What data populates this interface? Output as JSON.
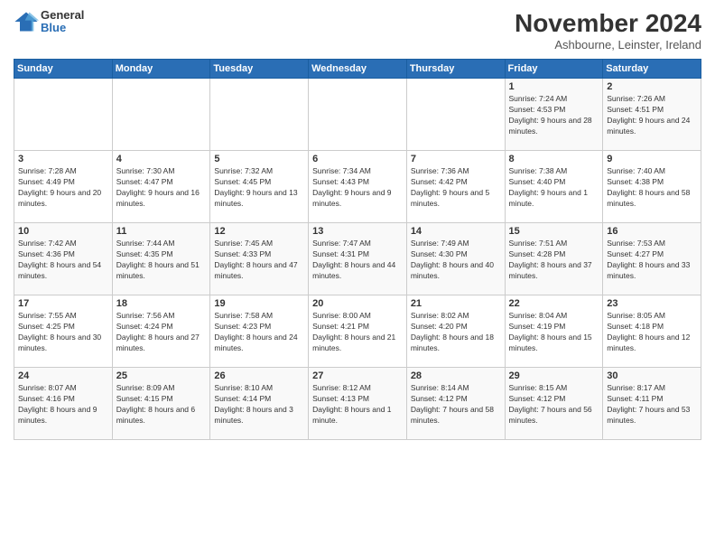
{
  "header": {
    "logo_general": "General",
    "logo_blue": "Blue",
    "month_title": "November 2024",
    "subtitle": "Ashbourne, Leinster, Ireland"
  },
  "days_of_week": [
    "Sunday",
    "Monday",
    "Tuesday",
    "Wednesday",
    "Thursday",
    "Friday",
    "Saturday"
  ],
  "weeks": [
    [
      {
        "day": "",
        "info": ""
      },
      {
        "day": "",
        "info": ""
      },
      {
        "day": "",
        "info": ""
      },
      {
        "day": "",
        "info": ""
      },
      {
        "day": "",
        "info": ""
      },
      {
        "day": "1",
        "info": "Sunrise: 7:24 AM\nSunset: 4:53 PM\nDaylight: 9 hours and 28 minutes."
      },
      {
        "day": "2",
        "info": "Sunrise: 7:26 AM\nSunset: 4:51 PM\nDaylight: 9 hours and 24 minutes."
      }
    ],
    [
      {
        "day": "3",
        "info": "Sunrise: 7:28 AM\nSunset: 4:49 PM\nDaylight: 9 hours and 20 minutes."
      },
      {
        "day": "4",
        "info": "Sunrise: 7:30 AM\nSunset: 4:47 PM\nDaylight: 9 hours and 16 minutes."
      },
      {
        "day": "5",
        "info": "Sunrise: 7:32 AM\nSunset: 4:45 PM\nDaylight: 9 hours and 13 minutes."
      },
      {
        "day": "6",
        "info": "Sunrise: 7:34 AM\nSunset: 4:43 PM\nDaylight: 9 hours and 9 minutes."
      },
      {
        "day": "7",
        "info": "Sunrise: 7:36 AM\nSunset: 4:42 PM\nDaylight: 9 hours and 5 minutes."
      },
      {
        "day": "8",
        "info": "Sunrise: 7:38 AM\nSunset: 4:40 PM\nDaylight: 9 hours and 1 minute."
      },
      {
        "day": "9",
        "info": "Sunrise: 7:40 AM\nSunset: 4:38 PM\nDaylight: 8 hours and 58 minutes."
      }
    ],
    [
      {
        "day": "10",
        "info": "Sunrise: 7:42 AM\nSunset: 4:36 PM\nDaylight: 8 hours and 54 minutes."
      },
      {
        "day": "11",
        "info": "Sunrise: 7:44 AM\nSunset: 4:35 PM\nDaylight: 8 hours and 51 minutes."
      },
      {
        "day": "12",
        "info": "Sunrise: 7:45 AM\nSunset: 4:33 PM\nDaylight: 8 hours and 47 minutes."
      },
      {
        "day": "13",
        "info": "Sunrise: 7:47 AM\nSunset: 4:31 PM\nDaylight: 8 hours and 44 minutes."
      },
      {
        "day": "14",
        "info": "Sunrise: 7:49 AM\nSunset: 4:30 PM\nDaylight: 8 hours and 40 minutes."
      },
      {
        "day": "15",
        "info": "Sunrise: 7:51 AM\nSunset: 4:28 PM\nDaylight: 8 hours and 37 minutes."
      },
      {
        "day": "16",
        "info": "Sunrise: 7:53 AM\nSunset: 4:27 PM\nDaylight: 8 hours and 33 minutes."
      }
    ],
    [
      {
        "day": "17",
        "info": "Sunrise: 7:55 AM\nSunset: 4:25 PM\nDaylight: 8 hours and 30 minutes."
      },
      {
        "day": "18",
        "info": "Sunrise: 7:56 AM\nSunset: 4:24 PM\nDaylight: 8 hours and 27 minutes."
      },
      {
        "day": "19",
        "info": "Sunrise: 7:58 AM\nSunset: 4:23 PM\nDaylight: 8 hours and 24 minutes."
      },
      {
        "day": "20",
        "info": "Sunrise: 8:00 AM\nSunset: 4:21 PM\nDaylight: 8 hours and 21 minutes."
      },
      {
        "day": "21",
        "info": "Sunrise: 8:02 AM\nSunset: 4:20 PM\nDaylight: 8 hours and 18 minutes."
      },
      {
        "day": "22",
        "info": "Sunrise: 8:04 AM\nSunset: 4:19 PM\nDaylight: 8 hours and 15 minutes."
      },
      {
        "day": "23",
        "info": "Sunrise: 8:05 AM\nSunset: 4:18 PM\nDaylight: 8 hours and 12 minutes."
      }
    ],
    [
      {
        "day": "24",
        "info": "Sunrise: 8:07 AM\nSunset: 4:16 PM\nDaylight: 8 hours and 9 minutes."
      },
      {
        "day": "25",
        "info": "Sunrise: 8:09 AM\nSunset: 4:15 PM\nDaylight: 8 hours and 6 minutes."
      },
      {
        "day": "26",
        "info": "Sunrise: 8:10 AM\nSunset: 4:14 PM\nDaylight: 8 hours and 3 minutes."
      },
      {
        "day": "27",
        "info": "Sunrise: 8:12 AM\nSunset: 4:13 PM\nDaylight: 8 hours and 1 minute."
      },
      {
        "day": "28",
        "info": "Sunrise: 8:14 AM\nSunset: 4:12 PM\nDaylight: 7 hours and 58 minutes."
      },
      {
        "day": "29",
        "info": "Sunrise: 8:15 AM\nSunset: 4:12 PM\nDaylight: 7 hours and 56 minutes."
      },
      {
        "day": "30",
        "info": "Sunrise: 8:17 AM\nSunset: 4:11 PM\nDaylight: 7 hours and 53 minutes."
      }
    ]
  ]
}
